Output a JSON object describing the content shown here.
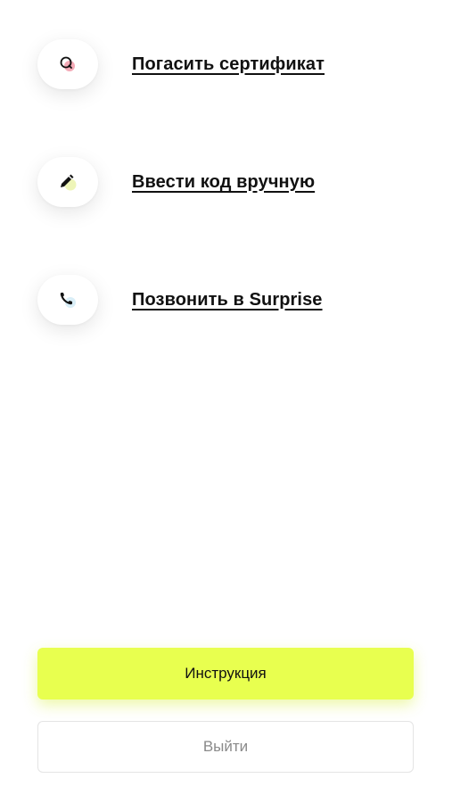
{
  "actions": [
    {
      "label": "Погасить сертификат",
      "icon": "redeem-icon",
      "accent": "#f4a9b6"
    },
    {
      "label": "Ввести код вручную",
      "icon": "pencil-icon",
      "accent": "#eef5b8"
    },
    {
      "label": "Позвонить в Surprise",
      "icon": "phone-icon",
      "accent": "#d9eef7"
    }
  ],
  "buttons": {
    "instruction_label": "Инструкция",
    "logout_label": "Выйти"
  },
  "colors": {
    "primary": "#e8ff4f",
    "text": "#111111",
    "muted": "#8a8a8a"
  }
}
